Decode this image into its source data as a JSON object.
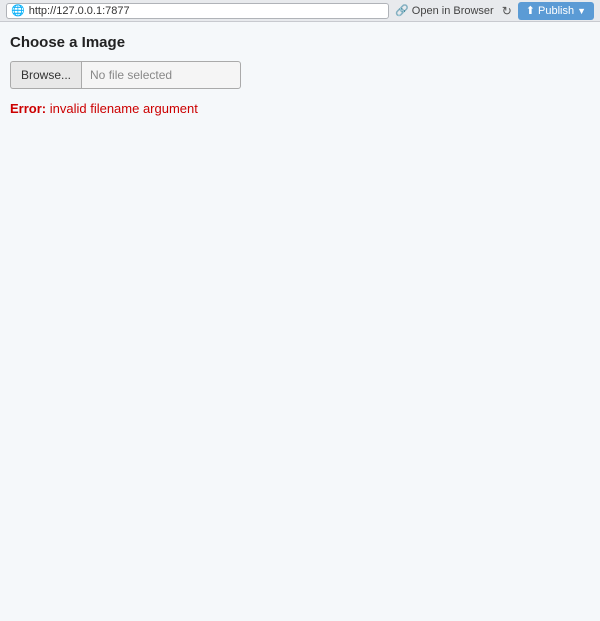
{
  "browser_bar": {
    "url": "http://127.0.0.1:7877",
    "open_in_browser_label": "Open in Browser",
    "publish_label": "Publish"
  },
  "page": {
    "heading": "Choose a Image",
    "browse_button_label": "Browse...",
    "file_placeholder": "No file selected",
    "error_label": "Error:",
    "error_message": " invalid filename argument"
  }
}
